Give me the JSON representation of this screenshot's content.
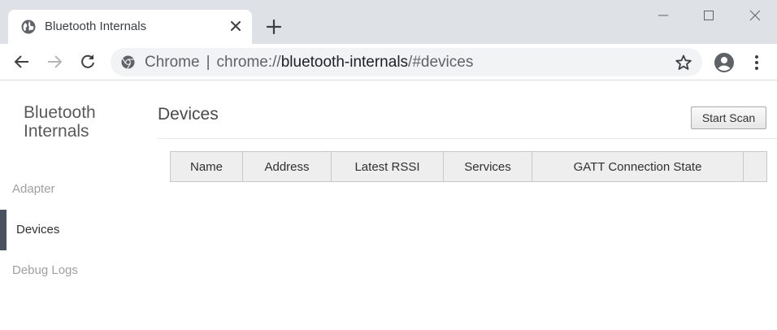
{
  "browser": {
    "tab_title": "Bluetooth Internals",
    "omnibox": {
      "site_label": "Chrome",
      "separator": "|",
      "scheme": "chrome://",
      "host": "bluetooth-internals",
      "path": "/#devices"
    }
  },
  "sidebar": {
    "title": "Bluetooth Internals",
    "items": [
      {
        "label": "Adapter",
        "active": false
      },
      {
        "label": "Devices",
        "active": true
      },
      {
        "label": "Debug Logs",
        "active": false
      }
    ]
  },
  "main": {
    "page_title": "Devices",
    "scan_button": "Start Scan",
    "table": {
      "columns": [
        "Name",
        "Address",
        "Latest RSSI",
        "Services",
        "GATT Connection State",
        ""
      ],
      "rows": []
    }
  },
  "colors": {
    "titlebar": "#dee1e6",
    "active_indicator": "#4a5260",
    "omnibox_bg": "#f1f3f4"
  },
  "icons": [
    "globe-icon",
    "close-icon",
    "plus-icon",
    "minimize-icon",
    "maximize-icon",
    "window-close-icon",
    "back-arrow-icon",
    "forward-arrow-icon",
    "reload-icon",
    "chrome-logo-icon",
    "star-icon",
    "profile-icon",
    "kebab-menu-icon"
  ]
}
